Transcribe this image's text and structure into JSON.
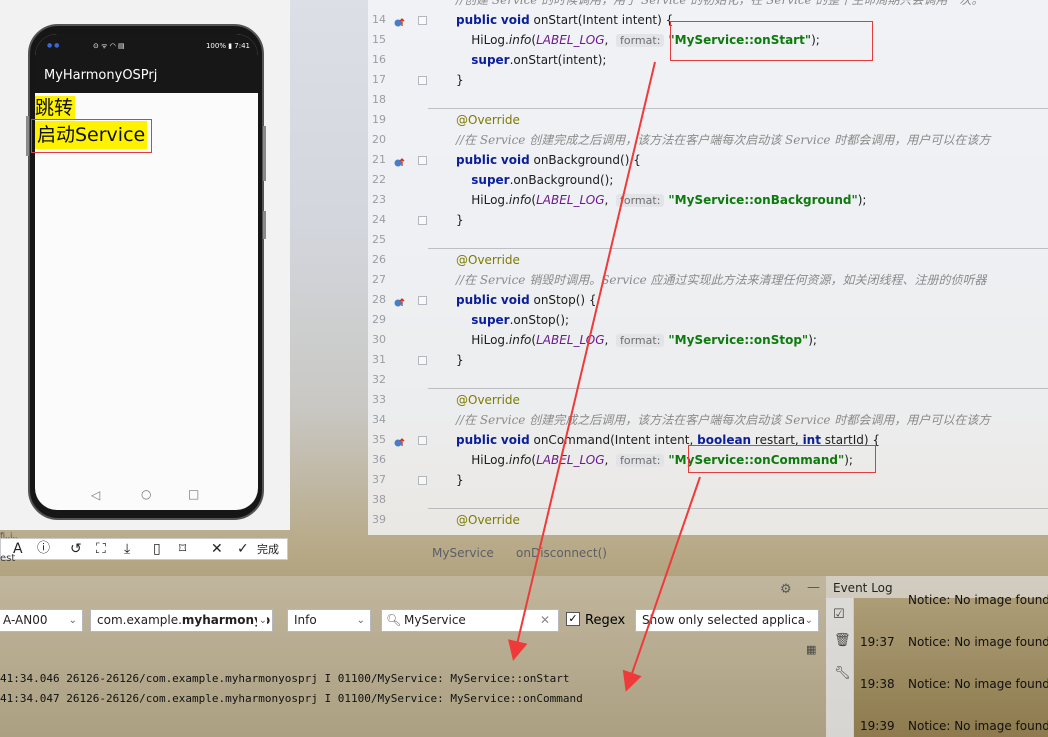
{
  "editor": {
    "lines": [
      {
        "num": "14",
        "kind": "sig",
        "name": "onStart",
        "args": "Intent intent"
      },
      {
        "num": "15",
        "kind": "log",
        "msg": "\"MyService::onStart\""
      },
      {
        "num": "16",
        "kind": "super",
        "call": "onStart(intent);"
      },
      {
        "num": "17",
        "kind": "close"
      },
      {
        "num": "18",
        "kind": "blank"
      },
      {
        "num": "19",
        "kind": "override"
      },
      {
        "num": "20",
        "kind": "comment",
        "text": "//在 Service 创建完成之后调用，该方法在客户端每次启动该 Service 时都会调用，用户可以在该方"
      },
      {
        "num": "21",
        "kind": "sig",
        "name": "onBackground",
        "args": ""
      },
      {
        "num": "22",
        "kind": "super",
        "call": "onBackground();"
      },
      {
        "num": "23",
        "kind": "log",
        "msg": "\"MyService::onBackground\""
      },
      {
        "num": "24",
        "kind": "close"
      },
      {
        "num": "25",
        "kind": "blank"
      },
      {
        "num": "26",
        "kind": "override"
      },
      {
        "num": "27",
        "kind": "comment",
        "text": "//在 Service 销毁时调用。Service 应通过实现此方法来清理任何资源，如关闭线程、注册的侦听器"
      },
      {
        "num": "28",
        "kind": "sig",
        "name": "onStop",
        "args": ""
      },
      {
        "num": "29",
        "kind": "super",
        "call": "onStop();"
      },
      {
        "num": "30",
        "kind": "log",
        "msg": "\"MyService::onStop\""
      },
      {
        "num": "31",
        "kind": "close"
      },
      {
        "num": "32",
        "kind": "blank"
      },
      {
        "num": "33",
        "kind": "override"
      },
      {
        "num": "34",
        "kind": "comment",
        "text": "//在 Service 创建完成之后调用，该方法在客户端每次启动该 Service 时都会调用，用户可以在该方"
      },
      {
        "num": "35",
        "kind": "sigcmd",
        "name": "onCommand"
      },
      {
        "num": "36",
        "kind": "log",
        "msg": "\"MyService::onCommand\""
      },
      {
        "num": "37",
        "kind": "close"
      },
      {
        "num": "38",
        "kind": "blank"
      },
      {
        "num": "39",
        "kind": "override"
      }
    ],
    "top_comment": "//创建 Service 的时候调用，用于 Service 的初始化，在 Service 的整个生命周期只会调用一次。",
    "tokens": {
      "public": "public",
      "void": "void",
      "super": "super",
      "hilog": "HiLog.",
      "info": "info",
      "label": "LABEL_LOG",
      "format": "format:",
      "override": "@Override",
      "boolean": "boolean",
      "int": "int",
      "cmd_args_a": "Intent intent, ",
      "cmd_args_b": " restart, ",
      "cmd_args_c": " startId) {"
    }
  },
  "breadcrumb": {
    "class_name": "MyService",
    "method_name": "onDisconnect()"
  },
  "phone": {
    "status_right": "100% ▮ 7:41",
    "status_left": "● ●",
    "app_title": "MyHarmonyOSPrj",
    "button_jump": "跳转",
    "button_start_service": "启动Service",
    "nav_back": "◁",
    "nav_home": "○",
    "nav_recent": "□"
  },
  "phone_toolbar": {
    "finish_label": "完成",
    "hidden_label": "fi..i..",
    "side_label": "est"
  },
  "logcat": {
    "device": "A-AN00",
    "process_prefix": "com.example.",
    "process_bold": "myharmonyo",
    "level": "Info",
    "search": "MyService",
    "regex_label": "Regex",
    "regex_checked": true,
    "filter": "Show only selected applica",
    "lines": [
      "41:34.046 26126-26126/com.example.myharmonyosprj I 01100/MyService: MyService::onStart",
      "41:34.047 26126-26126/com.example.myharmonyosprj I 01100/MyService: MyService::onCommand"
    ]
  },
  "event_log": {
    "title": "Event Log",
    "entries": [
      {
        "time": "",
        "text": "Notice: No image found"
      },
      {
        "time": "19:37",
        "text": "Notice: No image found"
      },
      {
        "time": "19:38",
        "text": "Notice: No image found"
      },
      {
        "time": "19:39",
        "text": "Notice: No image found"
      }
    ]
  },
  "colors": {
    "annotation_red": "#e23c3c",
    "highlight_yellow": "#fff200",
    "string_green": "#0d7a0d",
    "keyword_blue": "#0b1f9a"
  }
}
